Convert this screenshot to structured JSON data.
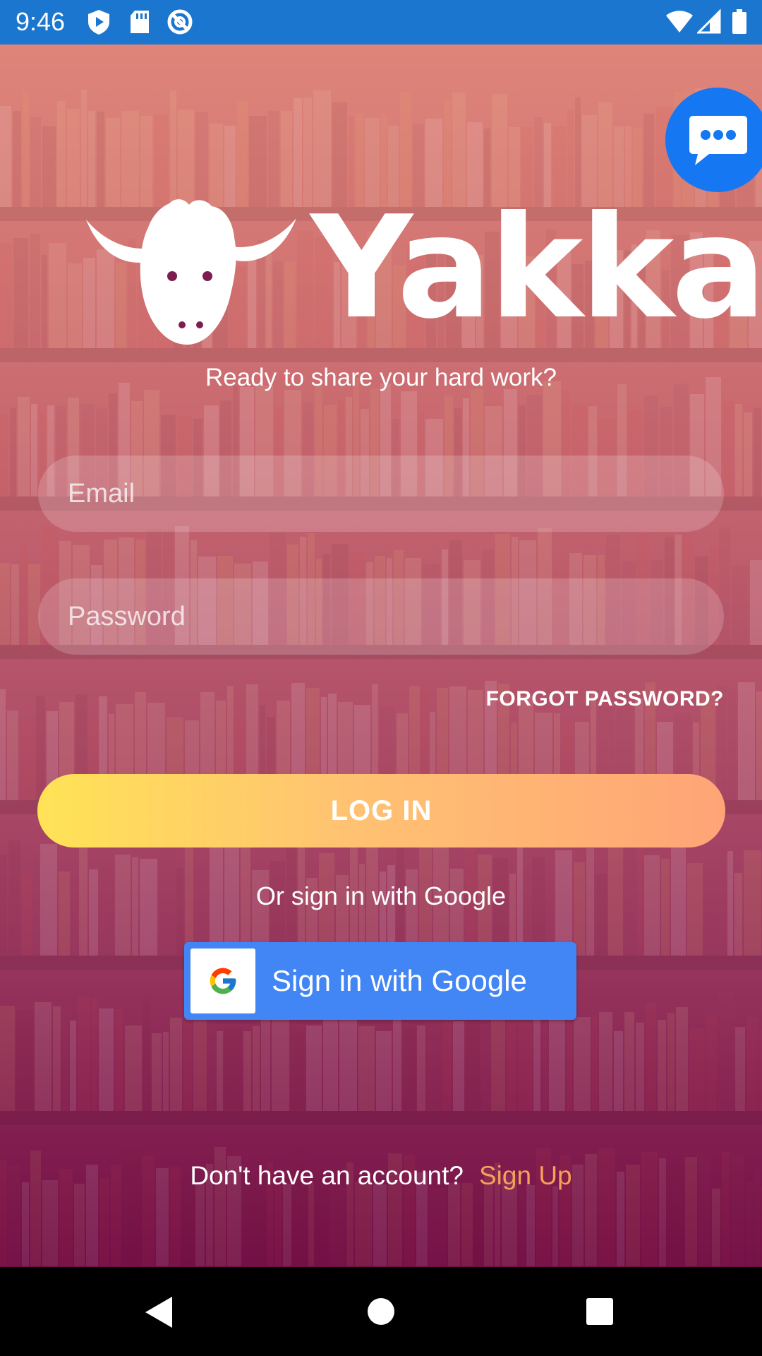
{
  "status_bar": {
    "time": "9:46",
    "left_icons": [
      "play-protect-icon",
      "sd-card-icon",
      "at-sign-icon"
    ],
    "right_icons": [
      "wifi-icon",
      "cell-signal-icon",
      "battery-icon"
    ],
    "background_color": "#1b76cf"
  },
  "chat": {
    "icon": "chat-bubble-icon",
    "color": "#1677f2"
  },
  "brand": {
    "name": "Yakka",
    "mascot_icon": "yak-head-icon",
    "tagline": "Ready to share your hard work?"
  },
  "login_form": {
    "email_placeholder": "Email",
    "email_value": "",
    "password_placeholder": "Password",
    "password_value": "",
    "forgot_label": "FORGOT PASSWORD?",
    "login_label": "LOG IN"
  },
  "google": {
    "caption": "Or sign in with Google",
    "button_label": "Sign in with Google",
    "icon": "google-g-icon",
    "button_color": "#4285f4"
  },
  "signup": {
    "prompt": "Don't have an account?",
    "link_label": "Sign Up",
    "link_color": "#f7a05a"
  },
  "nav_bar": {
    "icons": [
      "back-icon",
      "home-icon",
      "recents-icon"
    ]
  },
  "colors": {
    "login_gradient_start": "#ffe356",
    "login_gradient_end": "#ffa476"
  }
}
